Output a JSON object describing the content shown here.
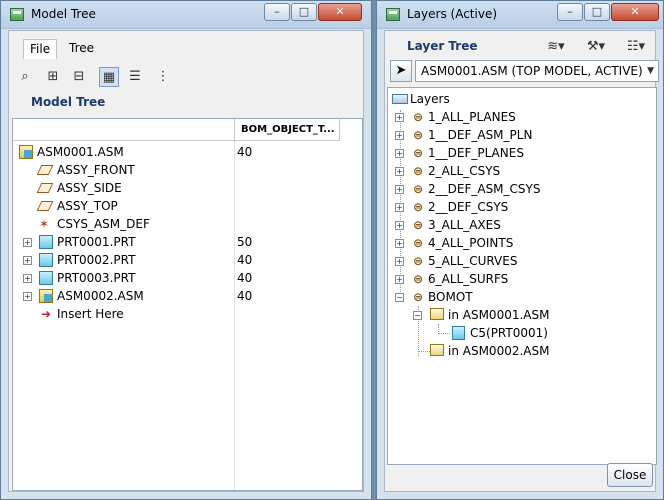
{
  "model_tree_window": {
    "title": "Model Tree",
    "menu": {
      "file": "File",
      "tree": "Tree"
    },
    "section_label": "Model Tree",
    "column_header": "BOM_OBJECT_T...",
    "rows": [
      {
        "label": "ASM0001.ASM",
        "value": "40"
      },
      {
        "label": "ASSY_FRONT",
        "value": ""
      },
      {
        "label": "ASSY_SIDE",
        "value": ""
      },
      {
        "label": "ASSY_TOP",
        "value": ""
      },
      {
        "label": "CSYS_ASM_DEF",
        "value": ""
      },
      {
        "label": "PRT0001.PRT",
        "value": "50"
      },
      {
        "label": "PRT0002.PRT",
        "value": "40"
      },
      {
        "label": "PRT0003.PRT",
        "value": "40"
      },
      {
        "label": "ASM0002.ASM",
        "value": "40"
      },
      {
        "label": "Insert Here",
        "value": ""
      }
    ],
    "toolbar_icons": [
      "binoculars-icon",
      "expand-tree-icon",
      "collapse-tree-icon",
      "show-tree-icon",
      "filter-icon",
      "columns-icon"
    ]
  },
  "layers_window": {
    "title": "Layers (Active)",
    "section_label": "Layer Tree",
    "model_select": "ASM0001.ASM (TOP MODEL, ACTIVE)",
    "root_label": "Layers",
    "layers": [
      "1_ALL_PLANES",
      "1__DEF_ASM_PLN",
      "1__DEF_PLANES",
      "2_ALL_CSYS",
      "2__DEF_ASM_CSYS",
      "2__DEF_CSYS",
      "3_ALL_AXES",
      "4_ALL_POINTS",
      "5_ALL_CURVES",
      "6_ALL_SURFS",
      "BOMOT"
    ],
    "bomot_children": {
      "first": "in ASM0001.ASM",
      "first_child": "C5(PRT0001)",
      "second": "in ASM0002.ASM"
    },
    "close_label": "Close"
  },
  "window_controls": {
    "minimize": "–",
    "maximize": "□",
    "close": "✕"
  }
}
